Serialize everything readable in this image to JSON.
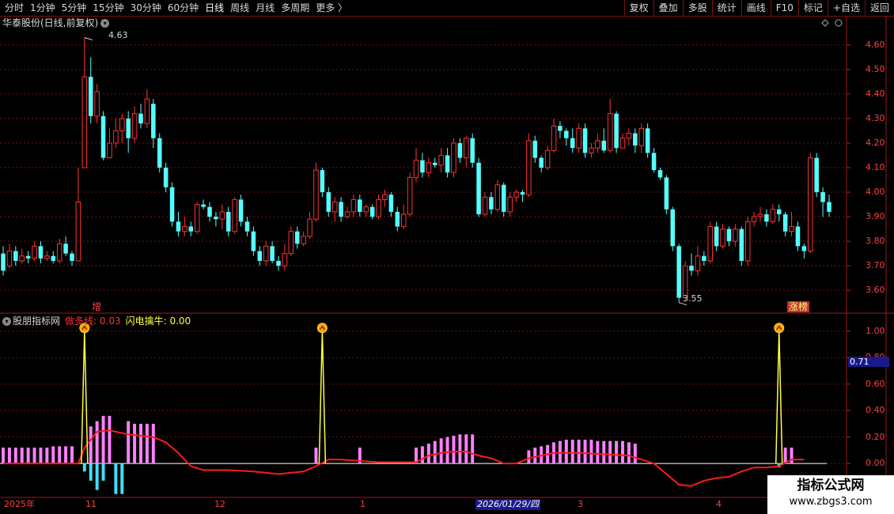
{
  "toolbar": {
    "periods": [
      "分时",
      "1分钟",
      "5分钟",
      "15分钟",
      "30分钟",
      "60分钟",
      "日线",
      "周线",
      "月线",
      "多周期",
      "更多 〉"
    ],
    "buttons": [
      "复权",
      "叠加",
      "多股",
      "统计",
      "画线",
      "F10",
      "标记",
      "+自选",
      "返回"
    ]
  },
  "stock_title": "华泰股份(日线,前复权)",
  "hi_label": "4.63",
  "lo_label": "3.55",
  "label_zeng": "增",
  "label_zhang": "涨榜",
  "indicator": {
    "name": "股朋指标网",
    "line1": "做多线: 0.03",
    "line2": "闪电擒牛: 0.00"
  },
  "current_value": "0.71",
  "x_labels": [
    "2025年",
    "11",
    "12",
    "1",
    "3",
    "4"
  ],
  "x_date": "2026/01/29/四",
  "watermark": {
    "line1": "指标公式网",
    "line2": "www.zbgs3.com"
  },
  "chart_data": [
    {
      "type": "candlestick",
      "ylim": [
        3.52,
        4.68
      ],
      "y_ticks": [
        3.6,
        3.7,
        3.8,
        3.9,
        4.0,
        4.1,
        4.2,
        4.3,
        4.4,
        4.5,
        4.6
      ],
      "candles": [
        [
          3.75,
          3.68,
          3.78,
          3.66
        ],
        [
          3.7,
          3.76,
          3.79,
          3.69
        ],
        [
          3.76,
          3.72,
          3.78,
          3.7
        ],
        [
          3.72,
          3.74,
          3.77,
          3.71
        ],
        [
          3.74,
          3.73,
          3.76,
          3.71
        ],
        [
          3.73,
          3.78,
          3.8,
          3.72
        ],
        [
          3.78,
          3.73,
          3.8,
          3.71
        ],
        [
          3.73,
          3.74,
          3.76,
          3.72
        ],
        [
          3.74,
          3.72,
          3.76,
          3.71
        ],
        [
          3.72,
          3.79,
          3.81,
          3.71
        ],
        [
          3.79,
          3.75,
          3.82,
          3.74
        ],
        [
          3.75,
          3.72,
          3.76,
          3.7
        ],
        [
          3.72,
          3.96,
          4.1,
          3.72
        ],
        [
          4.1,
          4.47,
          4.63,
          4.1
        ],
        [
          4.47,
          4.31,
          4.55,
          4.28
        ],
        [
          4.31,
          4.41,
          4.44,
          4.28
        ],
        [
          4.31,
          4.14,
          4.33,
          4.13
        ],
        [
          4.14,
          4.2,
          4.26,
          4.15
        ],
        [
          4.2,
          4.25,
          4.3,
          4.18
        ],
        [
          4.25,
          4.3,
          4.32,
          4.2
        ],
        [
          4.3,
          4.22,
          4.33,
          4.16
        ],
        [
          4.22,
          4.32,
          4.35,
          4.2
        ],
        [
          4.32,
          4.28,
          4.36,
          4.26
        ],
        [
          4.28,
          4.38,
          4.42,
          4.26
        ],
        [
          4.36,
          4.22,
          4.38,
          4.18
        ],
        [
          4.22,
          4.1,
          4.24,
          4.08
        ],
        [
          4.1,
          4.02,
          4.12,
          4.0
        ],
        [
          4.02,
          3.88,
          4.04,
          3.86
        ],
        [
          3.88,
          3.84,
          3.92,
          3.82
        ],
        [
          3.84,
          3.86,
          3.9,
          3.82
        ],
        [
          3.86,
          3.84,
          3.88,
          3.82
        ],
        [
          3.84,
          3.95,
          3.96,
          3.83
        ],
        [
          3.95,
          3.94,
          3.97,
          3.93
        ],
        [
          3.94,
          3.9,
          3.96,
          3.88
        ],
        [
          3.9,
          3.89,
          3.92,
          3.86
        ],
        [
          3.89,
          3.92,
          3.95,
          3.85
        ],
        [
          3.92,
          3.84,
          3.94,
          3.82
        ],
        [
          3.84,
          3.97,
          3.98,
          3.83
        ],
        [
          3.97,
          3.88,
          3.99,
          3.86
        ],
        [
          3.88,
          3.84,
          3.9,
          3.82
        ],
        [
          3.84,
          3.76,
          3.86,
          3.74
        ],
        [
          3.76,
          3.72,
          3.78,
          3.7
        ],
        [
          3.72,
          3.78,
          3.8,
          3.7
        ],
        [
          3.78,
          3.72,
          3.8,
          3.71
        ],
        [
          3.72,
          3.7,
          3.74,
          3.68
        ],
        [
          3.7,
          3.75,
          3.79,
          3.68
        ],
        [
          3.75,
          3.84,
          3.86,
          3.74
        ],
        [
          3.84,
          3.79,
          3.86,
          3.77
        ],
        [
          3.79,
          3.82,
          3.84,
          3.78
        ],
        [
          3.82,
          3.89,
          3.92,
          3.81
        ],
        [
          3.89,
          4.09,
          4.12,
          3.88
        ],
        [
          4.09,
          4.0,
          4.1,
          3.98
        ],
        [
          4.0,
          3.92,
          4.02,
          3.9
        ],
        [
          3.92,
          3.96,
          3.98,
          3.88
        ],
        [
          3.96,
          3.9,
          3.98,
          3.88
        ],
        [
          3.9,
          3.92,
          3.94,
          3.89
        ],
        [
          3.92,
          3.97,
          3.99,
          3.9
        ],
        [
          3.97,
          3.92,
          3.99,
          3.9
        ],
        [
          3.92,
          3.94,
          3.95,
          3.9
        ],
        [
          3.94,
          3.9,
          3.95,
          3.89
        ],
        [
          3.9,
          3.97,
          3.99,
          3.89
        ],
        [
          3.97,
          3.99,
          4.01,
          3.94
        ],
        [
          3.99,
          3.92,
          4.0,
          3.9
        ],
        [
          3.92,
          3.86,
          3.94,
          3.84
        ],
        [
          3.86,
          3.91,
          3.95,
          3.85
        ],
        [
          3.91,
          4.06,
          4.08,
          3.9
        ],
        [
          4.06,
          4.13,
          4.18,
          4.04
        ],
        [
          4.13,
          4.08,
          4.16,
          4.06
        ],
        [
          4.08,
          4.12,
          4.14,
          4.06
        ],
        [
          4.12,
          4.11,
          4.14,
          4.1
        ],
        [
          4.11,
          4.15,
          4.18,
          4.08
        ],
        [
          4.15,
          4.08,
          4.18,
          4.06
        ],
        [
          4.08,
          4.2,
          4.22,
          4.06
        ],
        [
          4.2,
          4.14,
          4.22,
          4.12
        ],
        [
          4.14,
          4.22,
          4.23,
          4.1
        ],
        [
          4.22,
          4.12,
          4.24,
          4.1
        ],
        [
          4.12,
          3.91,
          4.14,
          3.9
        ],
        [
          3.91,
          3.98,
          4.0,
          3.9
        ],
        [
          3.98,
          3.93,
          4.0,
          3.91
        ],
        [
          3.93,
          4.03,
          4.05,
          3.92
        ],
        [
          4.03,
          3.92,
          4.04,
          3.9
        ],
        [
          3.92,
          3.98,
          4.0,
          3.9
        ],
        [
          3.98,
          4.0,
          4.01,
          3.96
        ],
        [
          4.0,
          3.99,
          4.01,
          3.96
        ],
        [
          3.99,
          4.21,
          4.24,
          3.98
        ],
        [
          4.21,
          4.14,
          4.23,
          4.12
        ],
        [
          4.14,
          4.1,
          4.15,
          4.08
        ],
        [
          4.1,
          4.17,
          4.19,
          4.09
        ],
        [
          4.17,
          4.27,
          4.3,
          4.16
        ],
        [
          4.27,
          4.25,
          4.29,
          4.22
        ],
        [
          4.25,
          4.22,
          4.26,
          4.19
        ],
        [
          4.22,
          4.18,
          4.26,
          4.16
        ],
        [
          4.18,
          4.26,
          4.28,
          4.16
        ],
        [
          4.26,
          4.16,
          4.28,
          4.14
        ],
        [
          4.16,
          4.18,
          4.2,
          4.14
        ],
        [
          4.18,
          4.21,
          4.24,
          4.16
        ],
        [
          4.21,
          4.17,
          4.26,
          4.16
        ],
        [
          4.17,
          4.32,
          4.38,
          4.16
        ],
        [
          4.32,
          4.18,
          4.33,
          4.16
        ],
        [
          4.18,
          4.22,
          4.24,
          4.18
        ],
        [
          4.22,
          4.24,
          4.26,
          4.19
        ],
        [
          4.24,
          4.19,
          4.26,
          4.16
        ],
        [
          4.19,
          4.26,
          4.28,
          4.16
        ],
        [
          4.26,
          4.16,
          4.28,
          4.14
        ],
        [
          4.16,
          4.09,
          4.18,
          4.08
        ],
        [
          4.09,
          4.06,
          4.1,
          4.05
        ],
        [
          4.06,
          3.93,
          4.07,
          3.91
        ],
        [
          3.93,
          3.78,
          3.94,
          3.76
        ],
        [
          3.78,
          3.57,
          3.79,
          3.55
        ],
        [
          3.57,
          3.7,
          3.72,
          3.56
        ],
        [
          3.7,
          3.68,
          3.75,
          3.66
        ],
        [
          3.68,
          3.74,
          3.78,
          3.66
        ],
        [
          3.74,
          3.72,
          3.76,
          3.7
        ],
        [
          3.72,
          3.86,
          3.88,
          3.71
        ],
        [
          3.86,
          3.78,
          3.88,
          3.76
        ],
        [
          3.78,
          3.85,
          3.87,
          3.77
        ],
        [
          3.85,
          3.8,
          3.86,
          3.78
        ],
        [
          3.8,
          3.85,
          3.87,
          3.78
        ],
        [
          3.85,
          3.72,
          3.86,
          3.7
        ],
        [
          3.72,
          3.88,
          3.9,
          3.7
        ],
        [
          3.88,
          3.9,
          3.92,
          3.86
        ],
        [
          3.9,
          3.91,
          3.94,
          3.88
        ],
        [
          3.91,
          3.88,
          3.93,
          3.86
        ],
        [
          3.88,
          3.93,
          3.95,
          3.87
        ],
        [
          3.93,
          3.91,
          3.95,
          3.88
        ],
        [
          3.91,
          3.84,
          3.92,
          3.82
        ],
        [
          3.84,
          3.86,
          3.92,
          3.82
        ],
        [
          3.86,
          3.78,
          3.88,
          3.76
        ],
        [
          3.78,
          3.76,
          3.79,
          3.73
        ],
        [
          3.76,
          4.14,
          4.16,
          3.75
        ],
        [
          4.14,
          4.0,
          4.16,
          3.98
        ],
        [
          4.0,
          3.96,
          4.02,
          3.9
        ],
        [
          3.96,
          3.92,
          3.99,
          3.9
        ]
      ]
    },
    {
      "type": "indicator",
      "ylim": [
        -0.25,
        1.1
      ],
      "y_ticks": [
        0.0,
        0.2,
        0.4,
        0.6,
        0.8,
        1.0
      ],
      "pink_bars": [
        [
          0,
          0.12
        ],
        [
          1,
          0.12
        ],
        [
          2,
          0.12
        ],
        [
          3,
          0.12
        ],
        [
          4,
          0.12
        ],
        [
          5,
          0.12
        ],
        [
          6,
          0.12
        ],
        [
          7,
          0.12
        ],
        [
          8,
          0.13
        ],
        [
          9,
          0.13
        ],
        [
          10,
          0.13
        ],
        [
          11,
          0.13
        ],
        [
          14,
          0.28
        ],
        [
          15,
          0.32
        ],
        [
          16,
          0.36
        ],
        [
          17,
          0.36
        ],
        [
          20,
          0.32
        ],
        [
          21,
          0.3
        ],
        [
          22,
          0.3
        ],
        [
          23,
          0.3
        ],
        [
          24,
          0.3
        ],
        [
          50,
          0.12
        ],
        [
          57,
          0.12
        ],
        [
          66,
          0.12
        ],
        [
          67,
          0.13
        ],
        [
          68,
          0.15
        ],
        [
          69,
          0.17
        ],
        [
          70,
          0.19
        ],
        [
          71,
          0.2
        ],
        [
          72,
          0.21
        ],
        [
          73,
          0.22
        ],
        [
          74,
          0.22
        ],
        [
          75,
          0.22
        ],
        [
          84,
          0.1
        ],
        [
          85,
          0.12
        ],
        [
          86,
          0.13
        ],
        [
          87,
          0.14
        ],
        [
          88,
          0.16
        ],
        [
          89,
          0.17
        ],
        [
          90,
          0.18
        ],
        [
          91,
          0.18
        ],
        [
          92,
          0.18
        ],
        [
          93,
          0.18
        ],
        [
          94,
          0.18
        ],
        [
          95,
          0.17
        ],
        [
          96,
          0.17
        ],
        [
          97,
          0.17
        ],
        [
          98,
          0.17
        ],
        [
          99,
          0.17
        ],
        [
          100,
          0.16
        ],
        [
          101,
          0.15
        ],
        [
          125,
          0.12
        ],
        [
          126,
          0.12
        ]
      ],
      "cyan_bars": [
        [
          13,
          -0.06
        ],
        [
          14,
          -0.13
        ],
        [
          15,
          -0.2
        ],
        [
          16,
          -0.13
        ],
        [
          18,
          -0.23
        ],
        [
          19,
          -0.23
        ],
        [
          124,
          -0.03
        ]
      ],
      "red_line": [
        [
          0,
          0.0
        ],
        [
          12,
          0.0
        ],
        [
          13,
          0.12
        ],
        [
          15,
          0.24
        ],
        [
          17,
          0.25
        ],
        [
          20,
          0.22
        ],
        [
          24,
          0.2
        ],
        [
          26,
          0.16
        ],
        [
          28,
          0.08
        ],
        [
          30,
          -0.02
        ],
        [
          32,
          -0.05
        ],
        [
          36,
          -0.05
        ],
        [
          40,
          -0.06
        ],
        [
          44,
          -0.08
        ],
        [
          48,
          -0.06
        ],
        [
          50,
          -0.02
        ],
        [
          52,
          0.03
        ],
        [
          54,
          0.03
        ],
        [
          60,
          0.01
        ],
        [
          64,
          0.01
        ],
        [
          66,
          0.01
        ],
        [
          68,
          0.06
        ],
        [
          70,
          0.08
        ],
        [
          72,
          0.09
        ],
        [
          74,
          0.09
        ],
        [
          76,
          0.06
        ],
        [
          78,
          0.04
        ],
        [
          80,
          0.0
        ],
        [
          82,
          0.0
        ],
        [
          84,
          0.04
        ],
        [
          86,
          0.06
        ],
        [
          88,
          0.08
        ],
        [
          92,
          0.08
        ],
        [
          96,
          0.07
        ],
        [
          100,
          0.06
        ],
        [
          102,
          0.03
        ],
        [
          104,
          0.0
        ],
        [
          106,
          -0.08
        ],
        [
          108,
          -0.16
        ],
        [
          110,
          -0.17
        ],
        [
          112,
          -0.13
        ],
        [
          114,
          -0.11
        ],
        [
          116,
          -0.1
        ],
        [
          118,
          -0.06
        ],
        [
          120,
          -0.03
        ],
        [
          122,
          -0.03
        ],
        [
          124,
          -0.02
        ],
        [
          126,
          0.03
        ],
        [
          128,
          0.03
        ]
      ],
      "signals": [
        [
          13,
          1.0
        ],
        [
          51,
          1.0
        ],
        [
          124,
          1.0
        ]
      ],
      "yellow_base": 0.0
    }
  ]
}
